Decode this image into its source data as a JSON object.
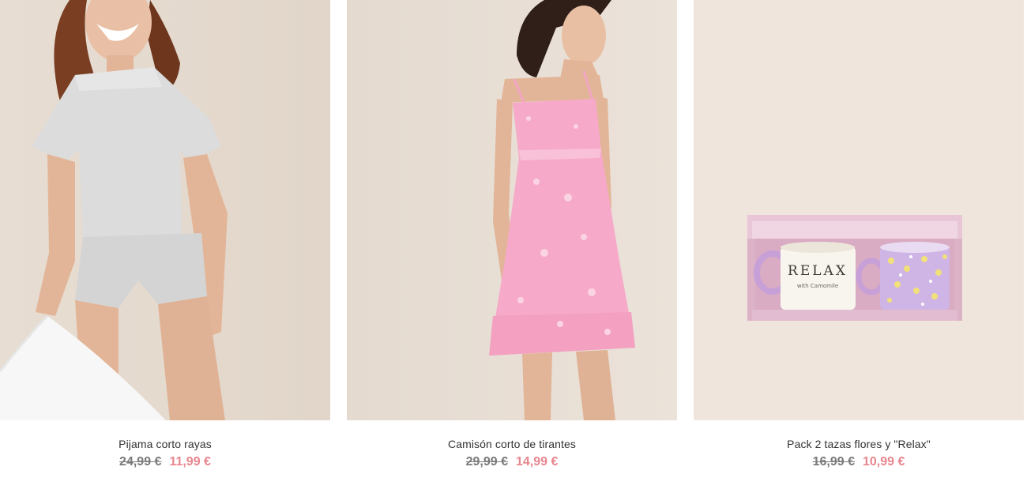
{
  "products": [
    {
      "image_icon": "pajama-photo-icon",
      "name": "Pijama corto rayas",
      "old_price": "24,99 €",
      "sale_price": "11,99 €"
    },
    {
      "image_icon": "nightgown-photo-icon",
      "name": "Camisón corto de tirantes",
      "old_price": "29,99 €",
      "sale_price": "14,99 €"
    },
    {
      "image_icon": "mug-pack-photo-icon",
      "name": "Pack 2 tazas flores y \"Relax\"",
      "old_price": "16,99 €",
      "sale_price": "10,99 €",
      "mug_text": "RELAX",
      "mug_subtext": "with Camomile"
    }
  ],
  "colors": {
    "sale_price": "#e8858e",
    "old_price": "#7a7a7a",
    "name": "#333333",
    "photo_background": "#ece4dc"
  }
}
